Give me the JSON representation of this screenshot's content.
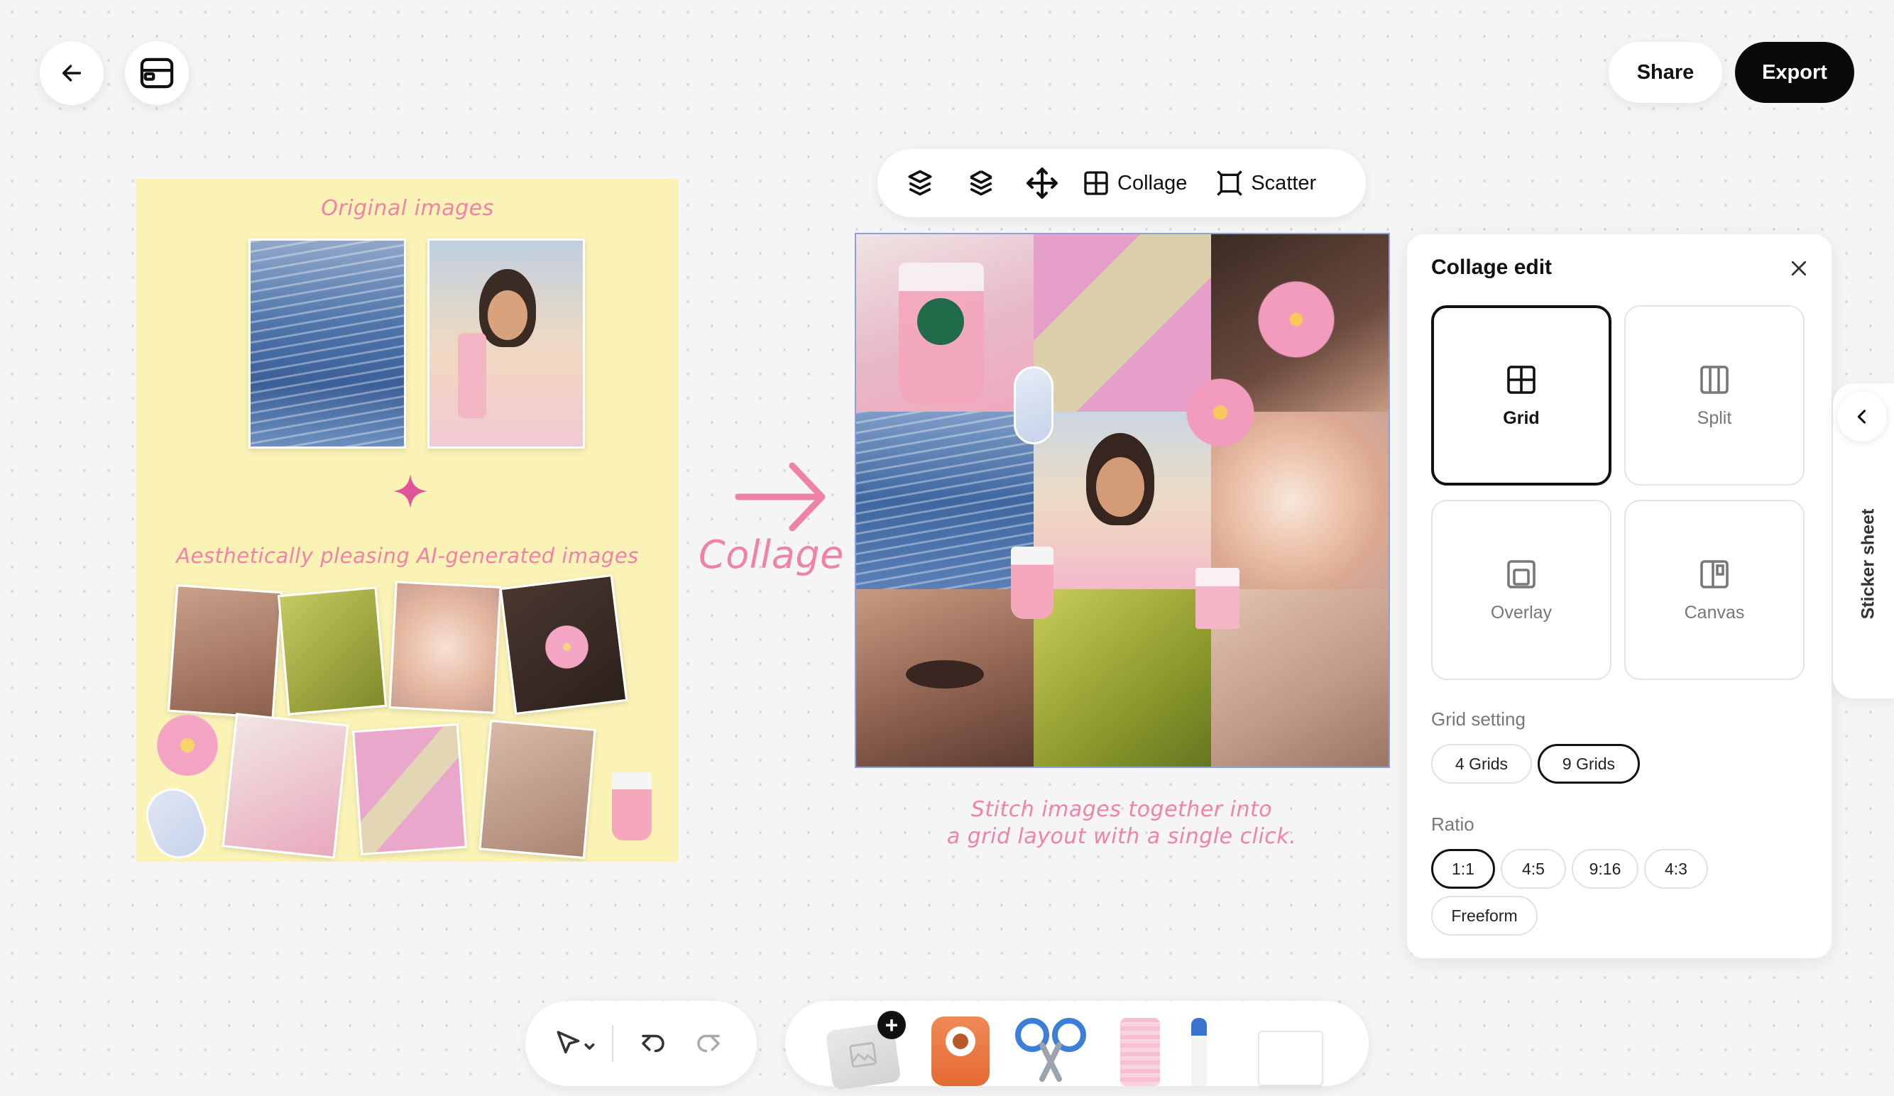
{
  "header": {
    "back_icon": "arrow-left-icon",
    "layers_icon": "card-stack-icon",
    "share_label": "Share",
    "export_label": "Export"
  },
  "board": {
    "top_title": "Original images",
    "bottom_title": "Aesthetically pleasing AI-generated images"
  },
  "arrow_label": "Collage",
  "caption_line1": "Stitch images together into",
  "caption_line2": "a grid layout with a single click.",
  "toolbar": {
    "icons": [
      "stack-up-icon",
      "stack-down-icon",
      "move-icon"
    ],
    "collage_label": "Collage",
    "scatter_label": "Scatter"
  },
  "panel": {
    "title": "Collage edit",
    "layouts": [
      {
        "label": "Grid",
        "active": true
      },
      {
        "label": "Split",
        "active": false
      },
      {
        "label": "Overlay",
        "active": false
      },
      {
        "label": "Canvas",
        "active": false
      }
    ],
    "grid_setting_label": "Grid setting",
    "grid_options": [
      {
        "label": "4 Grids",
        "active": false
      },
      {
        "label": "9 Grids",
        "active": true
      }
    ],
    "ratio_label": "Ratio",
    "ratio_options": [
      {
        "label": "1:1",
        "active": true
      },
      {
        "label": "4:5",
        "active": false
      },
      {
        "label": "9:16",
        "active": false
      },
      {
        "label": "4:3",
        "active": false
      },
      {
        "label": "Freeform",
        "active": false
      }
    ]
  },
  "sticker_sheet_label": "Sticker sheet",
  "colors": {
    "board_bg": "#fbf3b6",
    "accent_pink": "#ef82a8",
    "export_bg": "#0a0a0a"
  }
}
